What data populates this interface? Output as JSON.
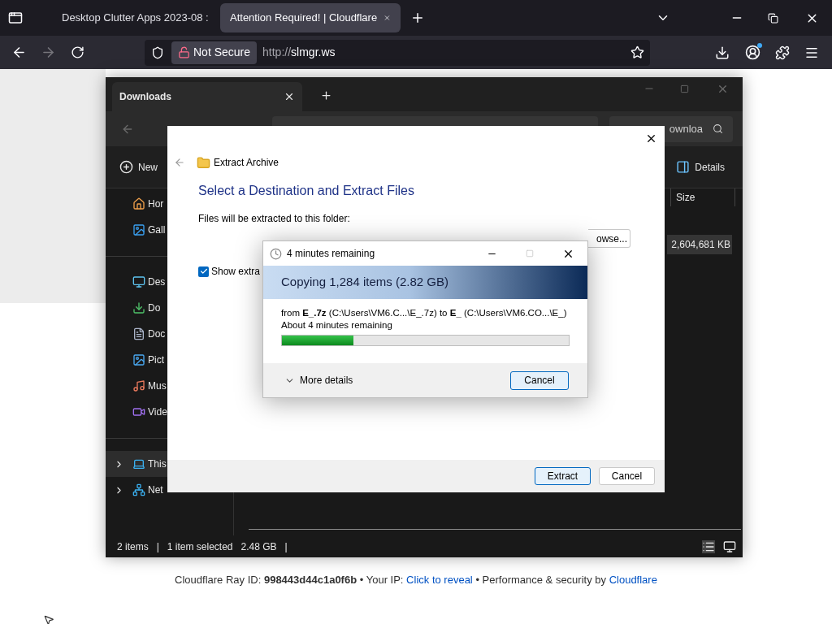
{
  "browser": {
    "tabs": [
      {
        "title": "Desktop Clutter Apps 2023-08 :",
        "selected": false
      },
      {
        "title": "Attention Required! | Cloudflare",
        "selected": true
      }
    ],
    "security_label": "Not Secure",
    "url_prefix": "http://",
    "url_host": "slmgr.ws"
  },
  "explorer": {
    "tab_title": "Downloads",
    "search_text": "ownloa",
    "new_label": "New",
    "details_label": "Details",
    "sidebar": [
      {
        "label": "Hor",
        "kind": "home",
        "selected": false
      },
      {
        "label": "Gall",
        "kind": "gallery",
        "selected": false
      },
      {
        "kind": "divider"
      },
      {
        "label": "Des",
        "kind": "desktop",
        "selected": false
      },
      {
        "label": "Do",
        "kind": "downloads",
        "selected": false
      },
      {
        "label": "Doc",
        "kind": "documents",
        "selected": false
      },
      {
        "label": "Pict",
        "kind": "pictures",
        "selected": false
      },
      {
        "label": "Mus",
        "kind": "music",
        "selected": false
      },
      {
        "label": "Vide",
        "kind": "videos",
        "selected": false
      },
      {
        "kind": "divider"
      },
      {
        "label": "This",
        "kind": "pc",
        "selected": true
      },
      {
        "label": "Net",
        "kind": "network",
        "selected": false
      }
    ],
    "column_header": "Size",
    "rows": [
      {
        "size": "2,604,681 KB",
        "selected": true
      }
    ],
    "status": [
      "2 items",
      "|",
      "1 item selected",
      "2.48 GB",
      "|"
    ]
  },
  "extract_dialog": {
    "title": "Extract Archive",
    "heading": "Select a Destination and Extract Files",
    "folder_label": "Files will be extracted to this folder:",
    "browse_label": "owse...",
    "show_checkbox": {
      "label": "Show extra",
      "checked": true
    },
    "buttons": [
      {
        "label": "Extract",
        "kind": "primary"
      },
      {
        "label": "Cancel",
        "kind": "secondary"
      }
    ]
  },
  "copy_dialog": {
    "title": "4 minutes remaining",
    "heading": "Copying 1,284 items (2.82 GB)",
    "details": "from **E_.7z** (C:\\Users\\VM6.C...\\E_.7z) to **E_** (C:\\Users\\VM6.CO...\\E_)",
    "time_left": "About 4 minutes remaining",
    "progress": {
      "level": 0.25
    },
    "more_details": "More details",
    "cancel": {
      "label": "Cancel",
      "kind": "primary"
    }
  },
  "footer": [
    {
      "kind": "text",
      "text": "Cloudflare Ray ID: **998443d44c1a0f6b**"
    },
    {
      "kind": "text",
      "text": "•"
    },
    {
      "kind": "text",
      "text": "Your IP:"
    },
    {
      "kind": "link",
      "text": "Click to reveal"
    },
    {
      "kind": "text",
      "text": "•"
    },
    {
      "kind": "text",
      "text": "Performance & security by"
    },
    {
      "kind": "link",
      "text": "Cloudflare"
    }
  ]
}
